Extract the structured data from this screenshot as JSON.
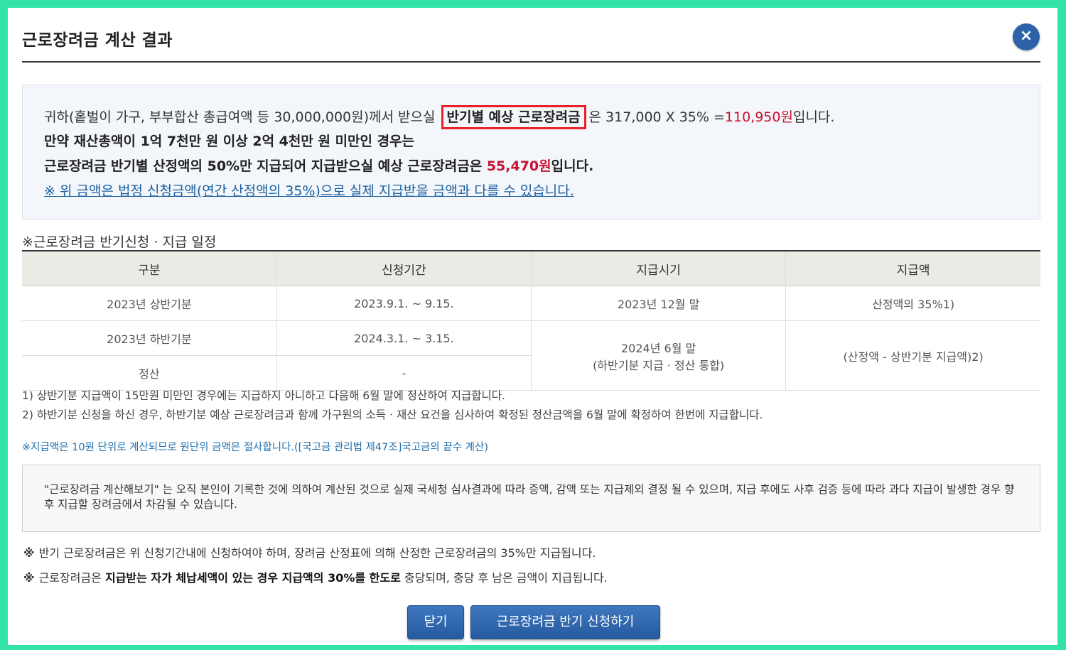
{
  "modal": {
    "title": "근로장려금 계산 결과",
    "close_icon": "×"
  },
  "summary": {
    "line1_pre": "귀하(홑벌이 가구, 부부합산 총급여액 등 30,000,000원)께서 받으실",
    "line1_boxed": "반기별 예상 근로장려금",
    "line1_mid": "은   317,000 X 35% =",
    "line1_amount": "110,950원",
    "line1_post": "입니다.",
    "line2": "만약 재산총액이 1억 7천만 원 이상 2억 4천만 원 미만인 경우는",
    "line3_pre": "근로장려금 반기별 산정액의 50%만 지급되어 지급받으실 예상 근로장려금은 ",
    "line3_amount": "55,470원",
    "line3_post": "입니다.",
    "line4_link": "※ 위 금액은 법정 신청금액(연간 산정액의 35%)으로 실제 지급받을 금액과 다를 수 있습니다."
  },
  "schedule": {
    "title": "※근로장려금 반기신청 · 지급 일정",
    "headers": [
      "구분",
      "신청기간",
      "지급시기",
      "지급액"
    ],
    "rows": [
      [
        "2023년 상반기분",
        "2023.9.1. ~ 9.15.",
        "2023년 12월 말",
        "산정액의 35%1)"
      ],
      [
        "2023년 하반기분",
        "2024.3.1. ~ 3.15."
      ],
      [
        "정산",
        "-"
      ]
    ],
    "merged_payment_time": "2024년 6월 말",
    "merged_payment_time_sub": "(하반기분 지급 · 정산 통합)",
    "merged_amount": "(산정액 - 상반기분 지급액)2)"
  },
  "notes": [
    "1) 상반기분 지급액이 15만원 미만인 경우에는 지급하지 아니하고 다음해 6월 말에 정산하여 지급합니다.",
    "2) 하반기분 신청을 하신 경우, 하반기분 예상 근로장려금과 함께 가구원의 소득 · 재산 요건을 심사하여 확정된 정산금액을 6월 말에 확정하여 한번에 지급합니다."
  ],
  "rounding_note": "※지급액은 10원 단위로 계산되므로 원단위 금액은 절사합니다.([국고금 관리법 제47조]국고금의 끝수 계산)",
  "disclaimer": "\"근로장려금 계산해보기\" 는 오직 본인이 기록한 것에 의하여 계산된 것으로 실제 국세청 심사결과에 따라 증액, 감액 또는 지급제외 결정 될 수 있으며, 지급 후에도 사후 검증 등에 따라 과다 지급이 발생한 경우 향후 지급할 장려금에서 차감될 수 있습니다.",
  "bullets": {
    "mark": "※",
    "b1": "반기 근로장려금은 위 신청기간내에 신청하여야 하며, 장려금 산정표에 의해 산정한 근로장려금의 35%만 지급됩니다.",
    "b2_pre": "근로장려금은 ",
    "b2_bold": "지급받는 자가 체납세액이 있는 경우 지급액의 30%를 한도로",
    "b2_post": " 충당되며, 충당 후 남은 금액이 지급됩니다."
  },
  "buttons": {
    "close": "닫기",
    "apply": "근로장려금 반기 신청하기"
  },
  "colors": {
    "frame": "#33e4a8",
    "accent_blue": "#2e62a8",
    "amount_red": "#c8102e",
    "highlight_box": "#e8202a"
  }
}
